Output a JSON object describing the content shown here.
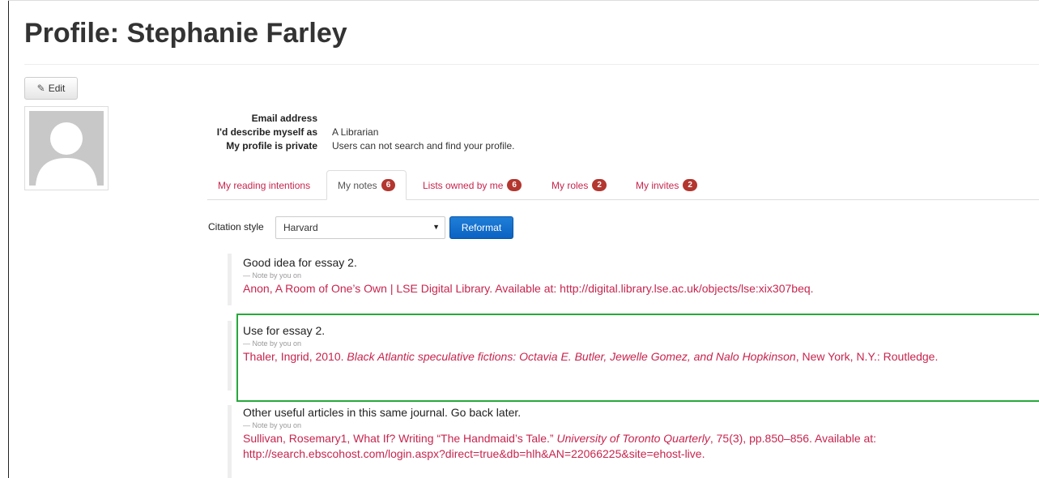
{
  "page": {
    "title": "Profile: Stephanie Farley"
  },
  "actions": {
    "edit_label": "Edit"
  },
  "profile_info": [
    {
      "label": "Email address",
      "value": ""
    },
    {
      "label": "I'd describe myself as",
      "value": "A Librarian"
    },
    {
      "label": "My profile is private",
      "value": "Users can not search and find your profile."
    }
  ],
  "tabs": [
    {
      "label": "My reading intentions",
      "badge": ""
    },
    {
      "label": "My notes",
      "badge": "6",
      "active": true
    },
    {
      "label": "Lists owned by me",
      "badge": "6"
    },
    {
      "label": "My roles",
      "badge": "2"
    },
    {
      "label": "My invites",
      "badge": "2"
    }
  ],
  "citation": {
    "label": "Citation style",
    "selected": "Harvard",
    "reformat_label": "Reformat"
  },
  "notes": [
    {
      "text": "Good idea for essay 2.",
      "by": "— Note by you on",
      "ref_pre": "Anon, A Room of One’s Own | LSE Digital Library. Available at: http://digital.library.lse.ac.uk/objects/lse:xix307beq.",
      "ref_italic": "",
      "ref_post": ""
    },
    {
      "text": "Use for essay 2.",
      "by": "— Note by you on",
      "ref_pre": "Thaler, Ingrid, 2010. ",
      "ref_italic": "Black Atlantic speculative fictions: Octavia E. Butler, Jewelle Gomez, and Nalo Hopkinson",
      "ref_post": ", New York, N.Y.: Routledge."
    },
    {
      "text": "Other useful articles in this same journal. Go back later.",
      "by": "— Note by you on",
      "ref_pre": "Sullivan, Rosemary1, What If? Writing “The Handmaid’s Tale.” ",
      "ref_italic": "University of Toronto Quarterly",
      "ref_post": ", 75(3), pp.850–856. Available at: http://search.ebscohost.com/login.aspx?direct=true&db=hlh&AN=22066225&site=ehost-live."
    }
  ],
  "colors": {
    "link": "#c7254e",
    "badge": "#b3362f",
    "primary_button": "#0b62c2",
    "highlight_border": "#27a83c"
  }
}
